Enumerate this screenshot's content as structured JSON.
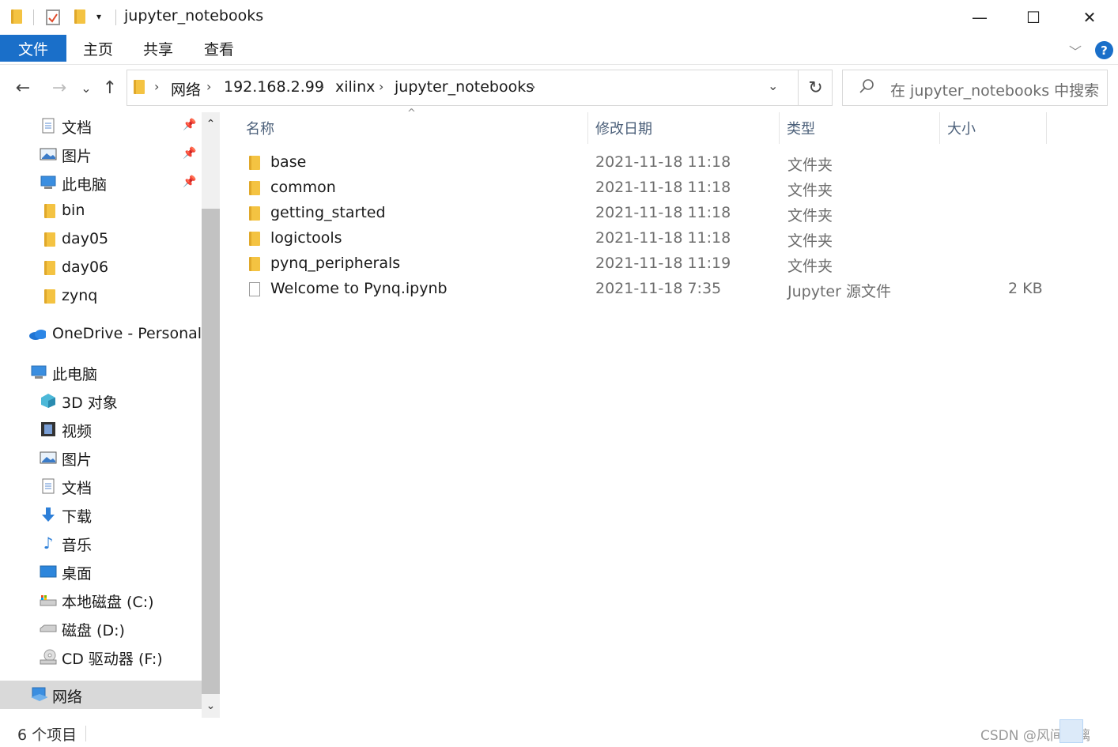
{
  "window": {
    "title": "jupyter_notebooks",
    "minimize": "—",
    "maximize": "☐",
    "close": "✕"
  },
  "ribbon": {
    "tabs": [
      "文件",
      "主页",
      "共享",
      "查看"
    ],
    "expand": "﹀",
    "help": "?"
  },
  "nav": {
    "back": "←",
    "forward": "→",
    "recent": "⌄",
    "up": "↑",
    "breadcrumbs": [
      "网络",
      "192.168.2.99",
      "xilinx",
      "jupyter_notebooks"
    ],
    "crumb_sep": "›",
    "dropdown": "⌄",
    "refresh": "↻",
    "search_placeholder": "在 jupyter_notebooks 中搜索"
  },
  "sidebar": {
    "items": [
      {
        "label": "文档",
        "icon": "documents-icon",
        "pinned": true
      },
      {
        "label": "图片",
        "icon": "pictures-icon",
        "pinned": true
      },
      {
        "label": "此电脑",
        "icon": "this-pc-icon",
        "pinned": true
      },
      {
        "label": "bin",
        "icon": "folder-icon"
      },
      {
        "label": "day05",
        "icon": "folder-icon"
      },
      {
        "label": "day06",
        "icon": "folder-icon"
      },
      {
        "label": "zynq",
        "icon": "folder-icon"
      },
      {
        "label": "OneDrive - Personal",
        "icon": "onedrive-icon"
      },
      {
        "label": "此电脑",
        "icon": "this-pc-icon"
      },
      {
        "label": "3D 对象",
        "icon": "3d-objects-icon"
      },
      {
        "label": "视频",
        "icon": "videos-icon"
      },
      {
        "label": "图片",
        "icon": "pictures-icon"
      },
      {
        "label": "文档",
        "icon": "documents-icon"
      },
      {
        "label": "下载",
        "icon": "downloads-icon"
      },
      {
        "label": "音乐",
        "icon": "music-icon"
      },
      {
        "label": "桌面",
        "icon": "desktop-icon"
      },
      {
        "label": "本地磁盘 (C:)",
        "icon": "local-disk-icon"
      },
      {
        "label": "磁盘 (D:)",
        "icon": "disk-icon"
      },
      {
        "label": "CD 驱动器 (F:)",
        "icon": "cd-drive-icon"
      },
      {
        "label": "网络",
        "icon": "network-icon",
        "selected": true
      }
    ],
    "pin_glyph": "📌",
    "scroll_up": "⌃",
    "scroll_down": "⌄"
  },
  "file_list": {
    "columns": [
      "名称",
      "修改日期",
      "类型",
      "大小"
    ],
    "sort_indicator": "^",
    "rows": [
      {
        "name": "base",
        "date": "2021-11-18 11:18",
        "type": "文件夹",
        "size": "",
        "icon": "folder-icon"
      },
      {
        "name": "common",
        "date": "2021-11-18 11:18",
        "type": "文件夹",
        "size": "",
        "icon": "folder-icon"
      },
      {
        "name": "getting_started",
        "date": "2021-11-18 11:18",
        "type": "文件夹",
        "size": "",
        "icon": "folder-icon"
      },
      {
        "name": "logictools",
        "date": "2021-11-18 11:18",
        "type": "文件夹",
        "size": "",
        "icon": "folder-icon"
      },
      {
        "name": "pynq_peripherals",
        "date": "2021-11-18 11:19",
        "type": "文件夹",
        "size": "",
        "icon": "folder-icon"
      },
      {
        "name": "Welcome to Pynq.ipynb",
        "date": "2021-11-18 7:35",
        "type": "Jupyter 源文件",
        "size": "2 KB",
        "icon": "file-icon"
      }
    ]
  },
  "status": {
    "item_count": "6 个项目",
    "watermark": "CSDN @风间琉璃"
  },
  "colors": {
    "accent": "#1a6fc9",
    "folder": "#f4c342",
    "header_text": "#4c607a",
    "selection": "#d9d9d9"
  }
}
